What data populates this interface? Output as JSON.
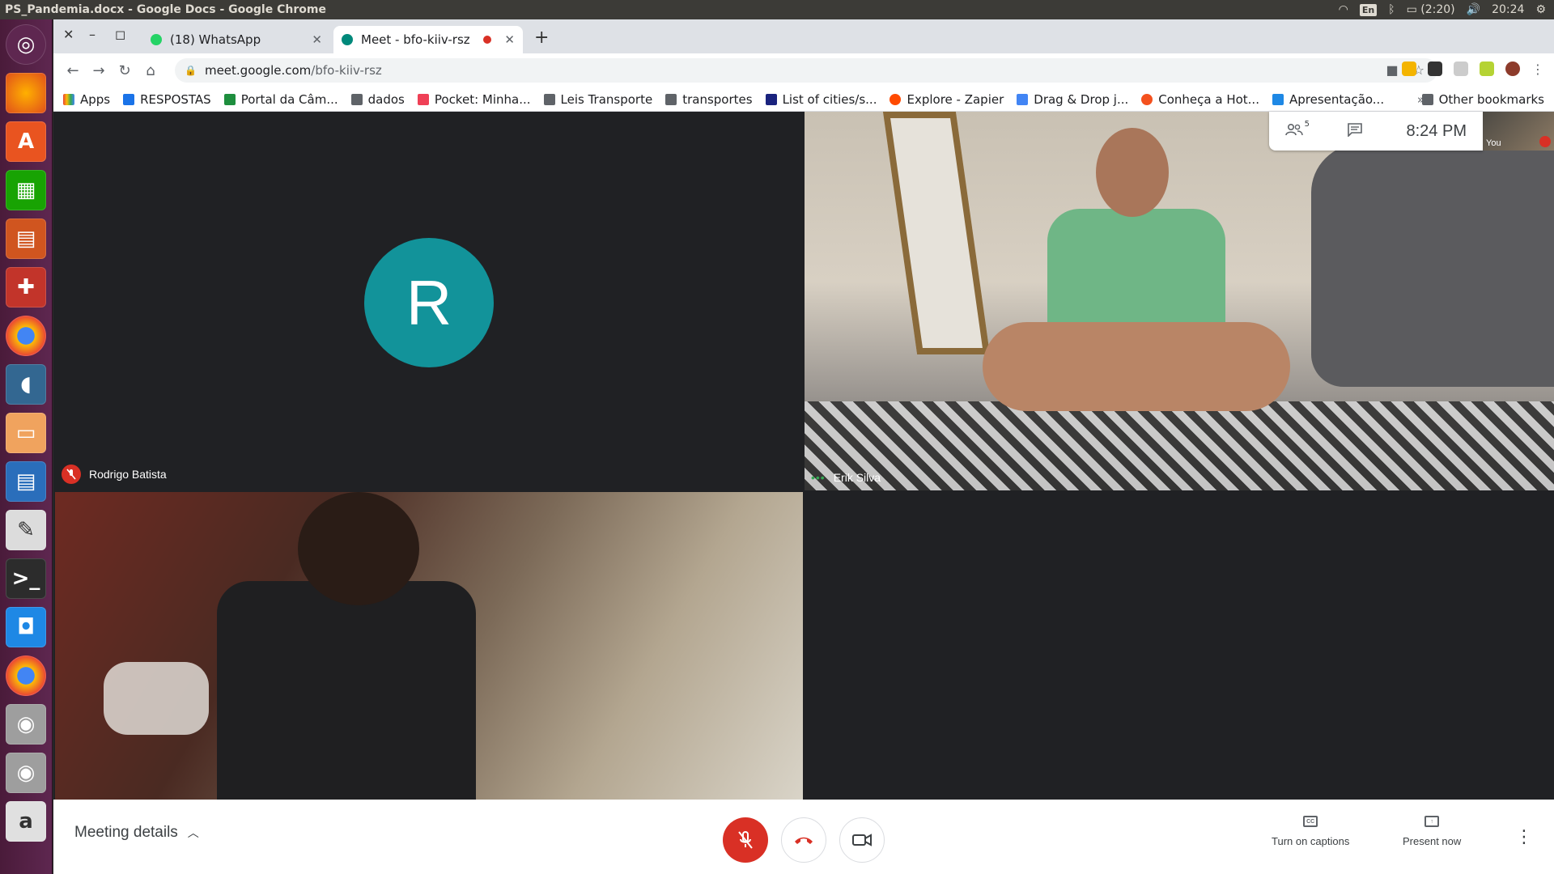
{
  "window": {
    "title": "PS_Pandemia.docx - Google Docs - Google Chrome",
    "battery": "(2:20)",
    "clock": "20:24",
    "lang": "En"
  },
  "tabs": [
    {
      "label": "(18) WhatsApp",
      "active": false
    },
    {
      "label": "Meet - bfo-kiiv-rsz",
      "active": true
    }
  ],
  "address": {
    "host": "meet.google.com",
    "path": "/bfo-kiiv-rsz"
  },
  "bookmarks": [
    {
      "label": "Apps"
    },
    {
      "label": "RESPOSTAS"
    },
    {
      "label": "Portal da Câm..."
    },
    {
      "label": "dados"
    },
    {
      "label": "Pocket: Minha..."
    },
    {
      "label": "Leis Transporte"
    },
    {
      "label": "transportes"
    },
    {
      "label": "List of cities/s..."
    },
    {
      "label": "Explore - Zapier"
    },
    {
      "label": "Drag & Drop j..."
    },
    {
      "label": "Conheça a Hot..."
    },
    {
      "label": "Apresentação..."
    }
  ],
  "bookmarks_more": "»",
  "other_bookmarks": "Other bookmarks",
  "meet": {
    "participants": [
      {
        "name": "Rodrigo Batista",
        "initial": "R",
        "muted": true
      },
      {
        "name": "Erik Silva",
        "muted": false
      }
    ],
    "people_count": "5",
    "time": "8:24 PM",
    "self_label": "You",
    "meeting_details": "Meeting details",
    "captions": "Turn on captions",
    "present": "Present now"
  },
  "colors": {
    "avatar": "#12939a",
    "danger": "#d93025",
    "meet_bg": "#202124"
  }
}
